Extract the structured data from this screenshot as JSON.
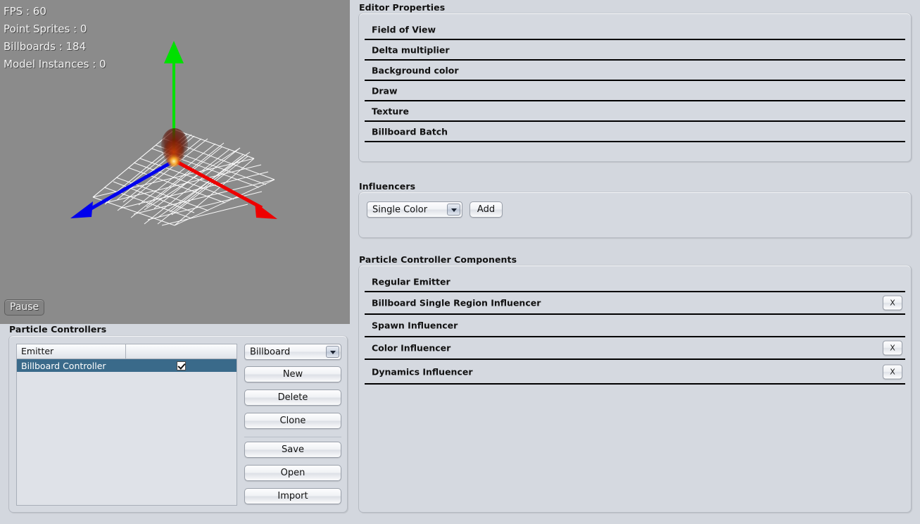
{
  "viewport": {
    "stats": [
      "FPS : 60",
      "Point Sprites : 0",
      "Billboards : 184",
      "Model Instances : 0"
    ],
    "pause_label": "Pause",
    "axes": [
      {
        "name": "y-axis-arrow",
        "color": "#00e000"
      },
      {
        "name": "x-axis-arrow",
        "color": "#ee0000"
      },
      {
        "name": "z-axis-arrow",
        "color": "#0000ee"
      }
    ],
    "grid_color": "#ffffff",
    "background_color": "#8b8b8b",
    "particle_effect": "flame-billboard-particles"
  },
  "editor_properties": {
    "title": "Editor Properties",
    "rows": [
      {
        "label": "Field of View",
        "removable": false
      },
      {
        "label": "Delta multiplier",
        "removable": false
      },
      {
        "label": "Background color",
        "removable": false
      },
      {
        "label": "Draw",
        "removable": false
      },
      {
        "label": "Texture",
        "removable": false
      },
      {
        "label": "Billboard Batch",
        "removable": false
      }
    ]
  },
  "influencers": {
    "title": "Influencers",
    "selected_type": "Single Color",
    "add_label": "Add"
  },
  "components": {
    "title": "Particle Controller Components",
    "rows": [
      {
        "label": "Regular Emitter",
        "removable": false
      },
      {
        "label": "Billboard Single Region Influencer",
        "removable": true,
        "remove_label": "X"
      },
      {
        "label": "Spawn Influencer",
        "removable": false
      },
      {
        "label": "Color Influencer",
        "removable": true,
        "remove_label": "X"
      },
      {
        "label": "Dynamics Influencer",
        "removable": true,
        "remove_label": "X"
      }
    ]
  },
  "controllers": {
    "title": "Particle Controllers",
    "table": {
      "headers": [
        "Emitter",
        ""
      ],
      "rows": [
        {
          "name": "Billboard Controller",
          "enabled": true,
          "selected": true
        }
      ]
    },
    "type_selector": "Billboard",
    "buttons": [
      "New",
      "Delete",
      "Clone",
      "Save",
      "Open",
      "Import"
    ]
  },
  "colors": {
    "selection": "#3a6a8a",
    "panel": "#d5d9e0",
    "background": "#d3d7de",
    "viewport": "#8b8b8b"
  }
}
